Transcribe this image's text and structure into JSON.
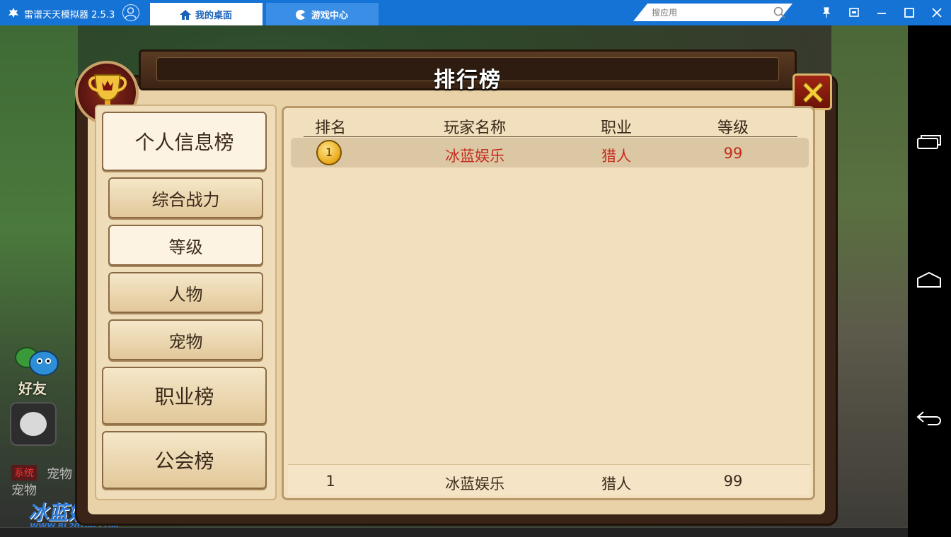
{
  "window": {
    "app_title": "雷谱天天模拟器 2.5.3",
    "tabs": [
      {
        "label": "我的桌面"
      },
      {
        "label": "游戏中心"
      }
    ],
    "search": {
      "placeholder": "搜应用"
    }
  },
  "dialog": {
    "title": "排行榜",
    "categories": [
      {
        "label": "个人信息榜"
      },
      {
        "label": "综合战力"
      },
      {
        "label": "等级"
      },
      {
        "label": "人物"
      },
      {
        "label": "宠物"
      },
      {
        "label": "职业榜"
      },
      {
        "label": "公会榜"
      }
    ],
    "table": {
      "headers": [
        "排名",
        "玩家名称",
        "职业",
        "等级"
      ],
      "rows": [
        {
          "rank": "1",
          "name": "冰蓝娱乐",
          "job": "猎人",
          "level": "99"
        }
      ],
      "self_row": {
        "rank": "1",
        "name": "冰蓝娱乐",
        "job": "猎人",
        "level": "99"
      }
    }
  },
  "hud": {
    "friend_label": "好友",
    "chat_tag": "系统",
    "chat_line1": "宠物",
    "chat_line2": "宠物",
    "watermark": "冰蓝娱乐",
    "watermark_url": "WWW.BL20166.COM"
  },
  "colors": {
    "titlebar": "#1673d6",
    "highlight_text": "#c42b1c",
    "parchment": "#e9d2a8"
  }
}
